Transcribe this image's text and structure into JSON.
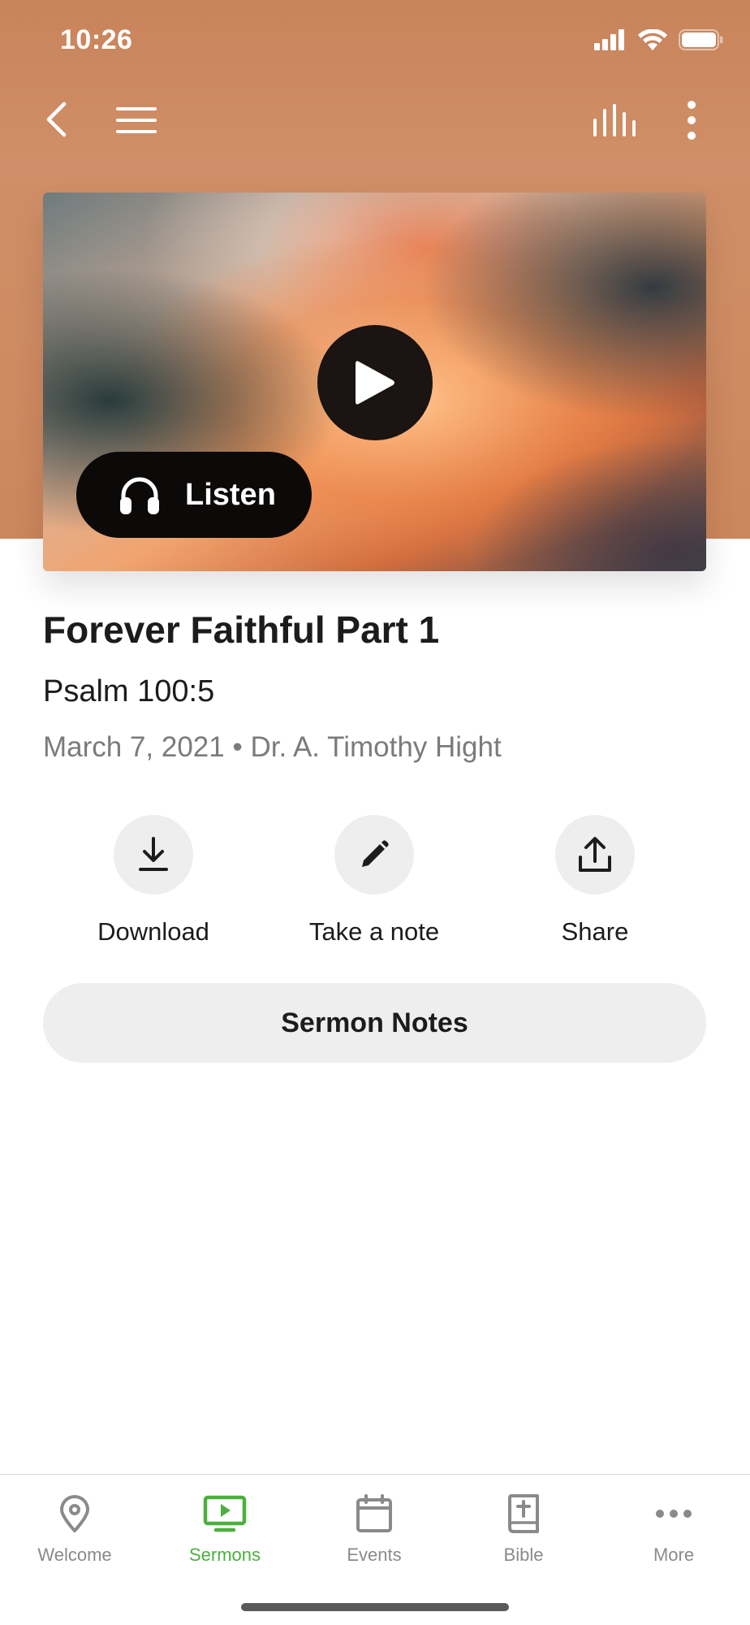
{
  "status_bar": {
    "time": "10:26"
  },
  "nav": {
    "back_icon": "chevron-left-icon",
    "menu_icon": "hamburger-menu-icon",
    "stats_icon": "audio-bars-icon",
    "more_icon": "vertical-ellipsis-icon"
  },
  "hero": {
    "play_icon": "play-icon",
    "listen_label": "Listen",
    "listen_icon": "headphones-icon"
  },
  "sermon": {
    "title": "Forever Faithful Part 1",
    "scripture": "Psalm 100:5",
    "meta": "March 7, 2021 • Dr. A. Timothy Hight"
  },
  "actions": [
    {
      "label": "Download",
      "icon": "download-icon"
    },
    {
      "label": "Take a note",
      "icon": "pencil-icon"
    },
    {
      "label": "Share",
      "icon": "share-icon"
    }
  ],
  "notes_button": {
    "label": "Sermon Notes"
  },
  "tabs": [
    {
      "label": "Welcome",
      "icon": "location-pin-icon",
      "active": false
    },
    {
      "label": "Sermons",
      "icon": "tv-play-icon",
      "active": true
    },
    {
      "label": "Events",
      "icon": "calendar-icon",
      "active": false
    },
    {
      "label": "Bible",
      "icon": "bible-icon",
      "active": false
    },
    {
      "label": "More",
      "icon": "more-dots-icon",
      "active": false
    }
  ],
  "colors": {
    "header": "#cc875e",
    "active_tab": "#4caf3e",
    "inactive_tab": "#8a8a8a",
    "button_bg": "#eeeeef"
  }
}
